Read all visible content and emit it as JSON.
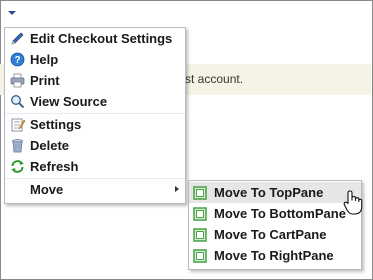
{
  "page": {
    "notice_text": "st account."
  },
  "menu": {
    "items": [
      {
        "label": "Edit Checkout Settings",
        "icon": "pencil-icon"
      },
      {
        "label": "Help",
        "icon": "help-icon"
      },
      {
        "label": "Print",
        "icon": "printer-icon"
      },
      {
        "label": "View Source",
        "icon": "magnifier-icon"
      },
      {
        "label": "Settings",
        "icon": "notepad-icon"
      },
      {
        "label": "Delete",
        "icon": "trash-icon"
      },
      {
        "label": "Refresh",
        "icon": "refresh-icon"
      },
      {
        "label": "Move",
        "icon": "none"
      }
    ]
  },
  "submenu": {
    "items": [
      {
        "label": "Move To TopPane",
        "icon": "pane-icon"
      },
      {
        "label": "Move To BottomPane",
        "icon": "pane-icon"
      },
      {
        "label": "Move To CartPane",
        "icon": "pane-icon"
      },
      {
        "label": "Move To RightPane",
        "icon": "pane-icon"
      }
    ],
    "hovered_index": 0
  },
  "colors": {
    "accent": "#2a4f93",
    "notice_bg": "#f6f3e6",
    "pane_green": "#3a9a3a",
    "hover_bg": "#e6e6e6"
  }
}
